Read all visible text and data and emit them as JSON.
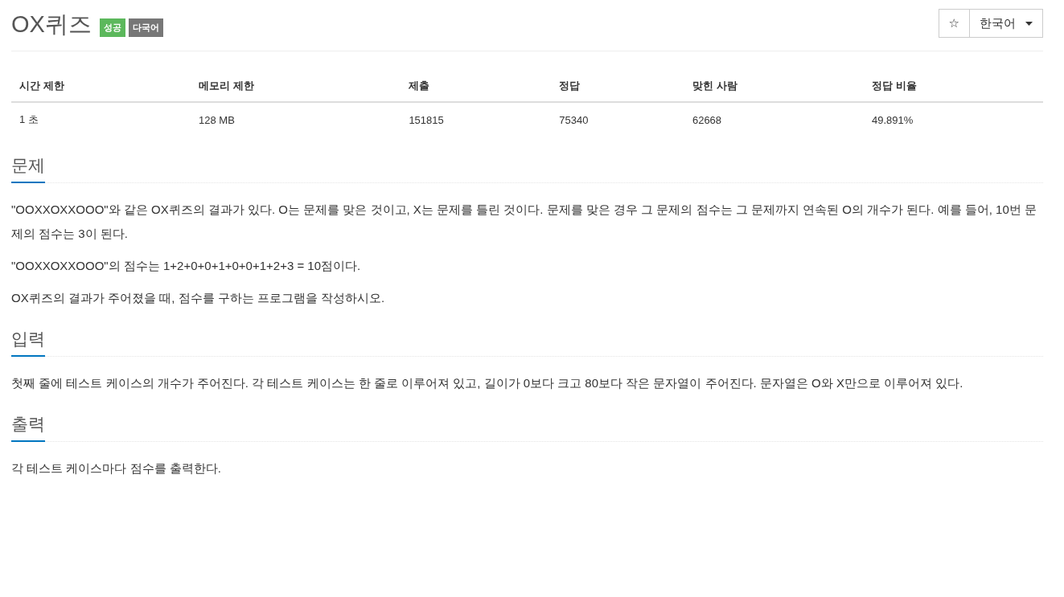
{
  "title": "OX퀴즈",
  "badges": [
    {
      "label": "성공",
      "color": "#5cb85c"
    },
    {
      "label": "다국어",
      "color": "#777777"
    }
  ],
  "favorite": {
    "icon": "☆"
  },
  "language": {
    "label": "한국어"
  },
  "table": {
    "columns": [
      "시간 제한",
      "메모리 제한",
      "제출",
      "정답",
      "맞힌 사람",
      "정답 비율"
    ],
    "rows": [
      [
        "1 초",
        "128 MB",
        "151815",
        "75340",
        "62668",
        "49.891%"
      ]
    ]
  },
  "sections": [
    {
      "heading": "문제",
      "paragraphs": [
        "\"OOXXOXXOOO\"와 같은 OX퀴즈의 결과가 있다. O는 문제를 맞은 것이고, X는 문제를 틀린 것이다. 문제를 맞은 경우 그 문제의 점수는 그 문제까지 연속된 O의 개수가 된다. 예를 들어, 10번 문제의 점수는 3이 된다.",
        "\"OOXXOXXOOO\"의 점수는 1+2+0+0+1+0+0+1+2+3 = 10점이다.",
        "OX퀴즈의 결과가 주어졌을 때, 점수를 구하는 프로그램을 작성하시오."
      ]
    },
    {
      "heading": "입력",
      "paragraphs": [
        "첫째 줄에 테스트 케이스의 개수가 주어진다. 각 테스트 케이스는 한 줄로 이루어져 있고, 길이가 0보다 크고 80보다 작은 문자열이 주어진다. 문자열은 O와 X만으로 이루어져 있다."
      ]
    },
    {
      "heading": "출력",
      "paragraphs": [
        "각 테스트 케이스마다 점수를 출력한다."
      ]
    }
  ]
}
